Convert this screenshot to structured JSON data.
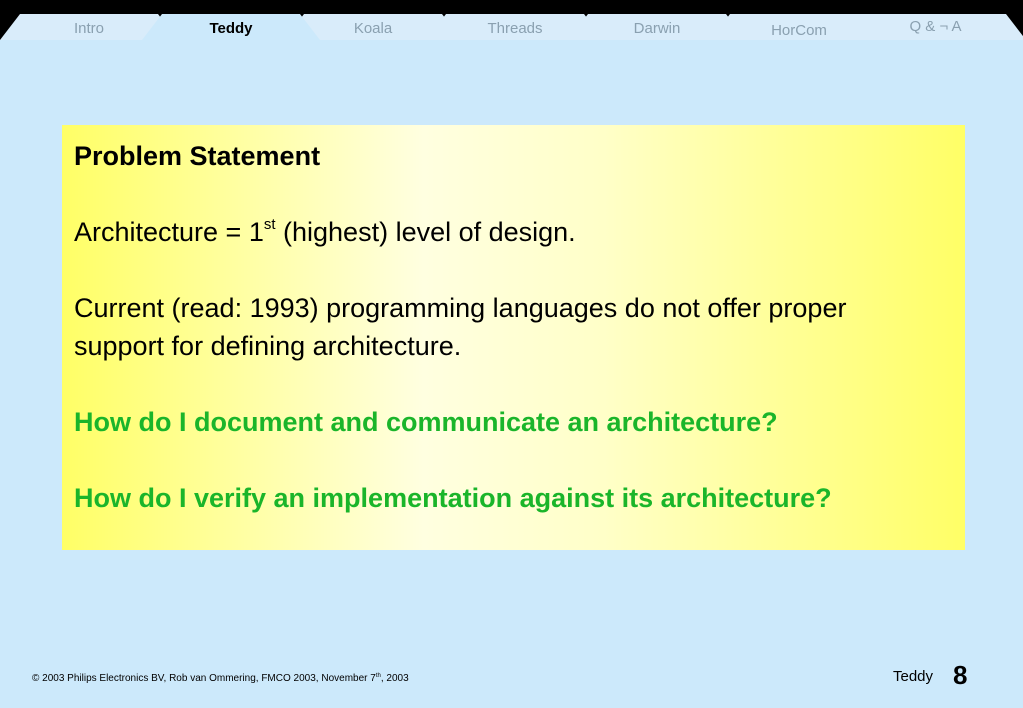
{
  "nav": {
    "tabs": [
      {
        "label": "Intro"
      },
      {
        "label": "Teddy"
      },
      {
        "label": "Koala"
      },
      {
        "label": "Threads"
      },
      {
        "label": "Darwin"
      },
      {
        "label": "HorCom"
      },
      {
        "label": "Q & ¬ A"
      }
    ],
    "active_tab": "Teddy"
  },
  "slide": {
    "title": "Problem Statement",
    "arch_pre": "Architecture = 1",
    "arch_sup": "st",
    "arch_post": " (highest) level of design.",
    "current_text": "Current (read: 1993) programming languages do not offer proper support for defining architecture.",
    "question1": "How do I document and communicate an architecture?",
    "question2": "How do I verify an implementation against its architecture?"
  },
  "footer": {
    "copyright_pre": "© 2003 Philips Electronics BV, Rob van Ommering, FMCO 2003, November 7",
    "copyright_sup": "th",
    "copyright_post": ", 2003",
    "section": "Teddy",
    "page_number": "8"
  },
  "colors": {
    "background": "#cce9fb",
    "content_box": "#ffff66",
    "question_text": "#1ab52a"
  }
}
